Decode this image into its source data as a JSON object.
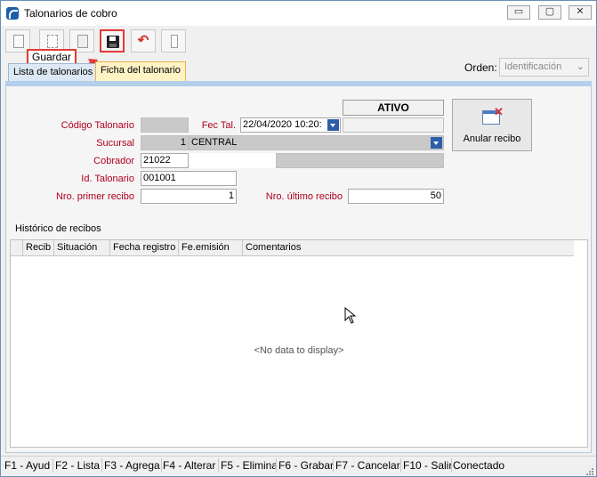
{
  "window": {
    "title": "Talonarios de cobro",
    "controls": {
      "minimize": "▭",
      "maximize": "▢",
      "close": "✕"
    }
  },
  "toolbar": {
    "buttons": [
      {
        "name": "new-icon"
      },
      {
        "name": "copy-icon"
      },
      {
        "name": "delete-icon"
      },
      {
        "name": "save-icon",
        "highlighted": true
      },
      {
        "name": "undo-icon"
      },
      {
        "name": "exit-icon"
      }
    ],
    "tooltip": "Guardar",
    "orden_label": "Orden:",
    "orden_value": "Identificación"
  },
  "tabs": [
    {
      "label": "Lista de talonarios",
      "active": false
    },
    {
      "label": "Ficha del talonario",
      "active": true
    }
  ],
  "form": {
    "status": "ATIVO",
    "codigo_label": "Código Talonario",
    "codigo_value": "",
    "fec_label": "Fec Tal.",
    "fec_value": "22/04/2020 10:20:",
    "sucursal_label": "Sucursal",
    "sucursal_code": "1",
    "sucursal_name": "CENTRAL",
    "cobrador_label": "Cobrador",
    "cobrador_value": "21022",
    "id_label": "Id. Talonario",
    "id_value": "001001",
    "primer_label": "Nro. primer recibo",
    "primer_value": "1",
    "ultimo_label": "Nro. último recibo",
    "ultimo_value": "50",
    "anular_label": "Anular recibo",
    "anular_icon": "window-delete-icon"
  },
  "history": {
    "label": "Histórico de recibos",
    "columns": [
      "Recib",
      "Situación",
      "Fecha registro",
      "Fe.emisión",
      "Comentarios"
    ],
    "rows": [],
    "empty_text": "<No data to display>"
  },
  "statusbar": {
    "keys": [
      "F1 - Ayud",
      "F2 - Lista",
      "F3 - Agrega",
      "F4 - Alterar",
      "F5 - Elimina",
      "F6 - Grabar",
      "F7 - Cancelar",
      "F10 - Salir"
    ],
    "state": "Conectado"
  },
  "colors": {
    "label_red": "#b0001e",
    "active_tab": "#fff3c6",
    "highlight_red": "#e53935",
    "header_blue": "#b3cfea"
  }
}
